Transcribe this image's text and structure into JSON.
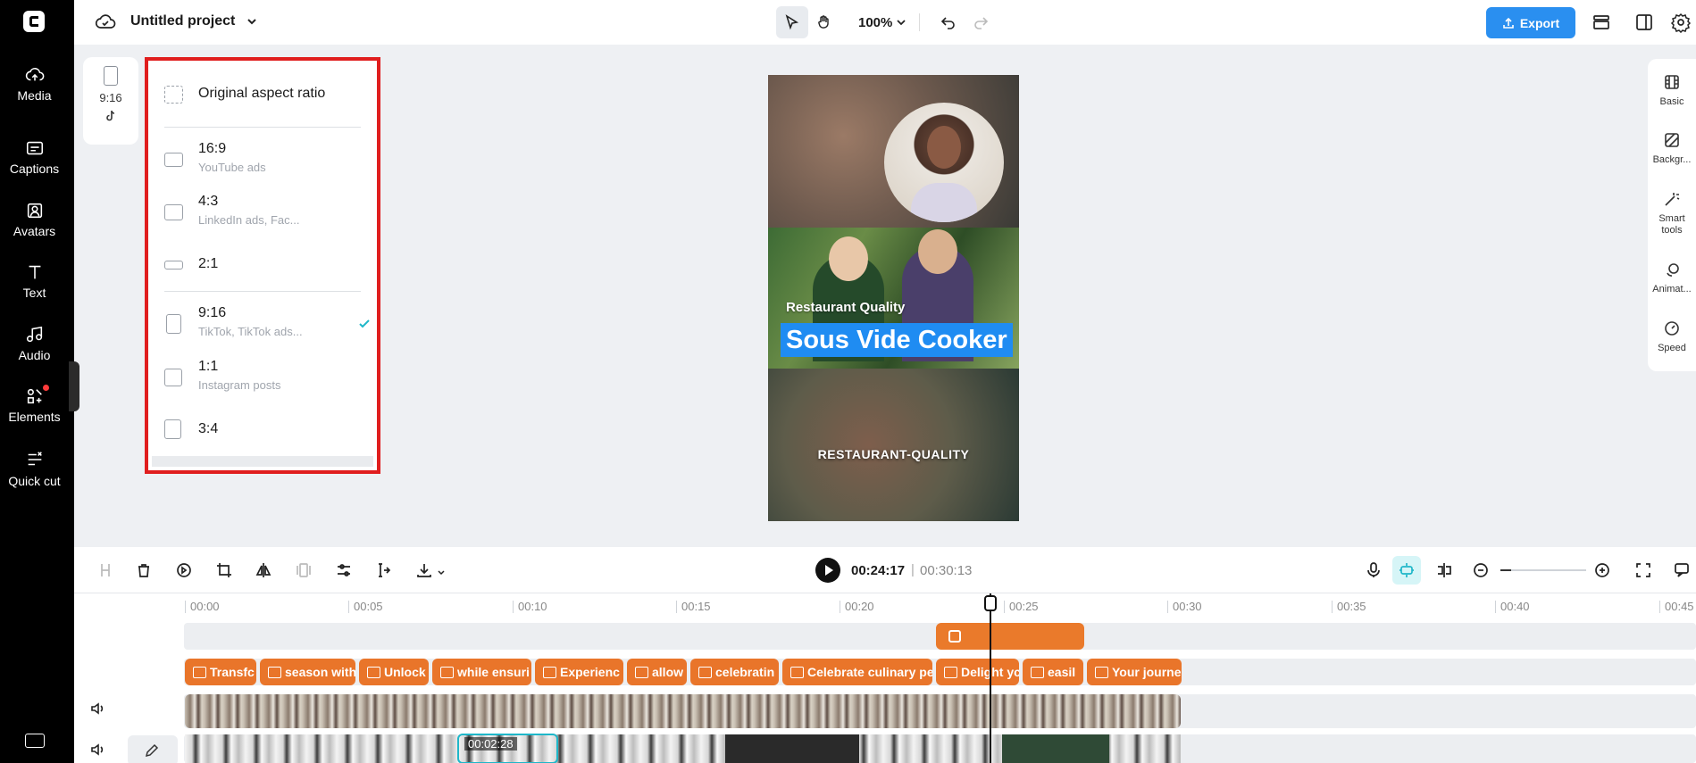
{
  "app": {
    "project_title": "Untitled project",
    "zoom": "100%",
    "export_label": "Export"
  },
  "sidebar": {
    "items": [
      {
        "label": "Media",
        "icon": "cloud-upload-icon"
      },
      {
        "label": "Captions",
        "icon": "captions-icon"
      },
      {
        "label": "Avatars",
        "icon": "avatar-icon"
      },
      {
        "label": "Text",
        "icon": "text-icon"
      },
      {
        "label": "Audio",
        "icon": "music-note-icon"
      },
      {
        "label": "Elements",
        "icon": "elements-icon"
      },
      {
        "label": "Quick cut",
        "icon": "quick-cut-icon"
      }
    ]
  },
  "ratio_mini": {
    "label": "9:16"
  },
  "ratio_panel": {
    "original": "Original aspect ratio",
    "options": [
      {
        "label": "16:9",
        "sub": "YouTube ads"
      },
      {
        "label": "4:3",
        "sub": "LinkedIn ads, Fac..."
      },
      {
        "label": "2:1",
        "sub": ""
      },
      {
        "label": "9:16",
        "sub": "TikTok, TikTok ads...",
        "selected": true
      },
      {
        "label": "1:1",
        "sub": "Instagram posts"
      },
      {
        "label": "3:4",
        "sub": ""
      }
    ]
  },
  "canvas": {
    "text_small": "Restaurant Quality",
    "text_big": "Sous Vide Cooker",
    "text_bottom": "RESTAURANT-QUALITY"
  },
  "right_panel": {
    "items": [
      {
        "label": "Basic"
      },
      {
        "label": "Backgr..."
      },
      {
        "label": "Smart tools"
      },
      {
        "label": "Animat..."
      },
      {
        "label": "Speed"
      }
    ]
  },
  "timeline": {
    "current_time": "00:24:17",
    "separator": "|",
    "total_time": "00:30:13",
    "ruler": [
      "00:00",
      "00:05",
      "00:10",
      "00:15",
      "00:20",
      "00:25",
      "00:30",
      "00:35",
      "00:40",
      "00:45"
    ],
    "captions": [
      "Transfc",
      "season with",
      "Unlock",
      "while ensuri",
      "Experienc",
      "allow",
      "celebratin",
      "Celebrate culinary pe",
      "Delight yc",
      "easil",
      "Your journe"
    ],
    "selected_clip_time": "00:02:28"
  }
}
